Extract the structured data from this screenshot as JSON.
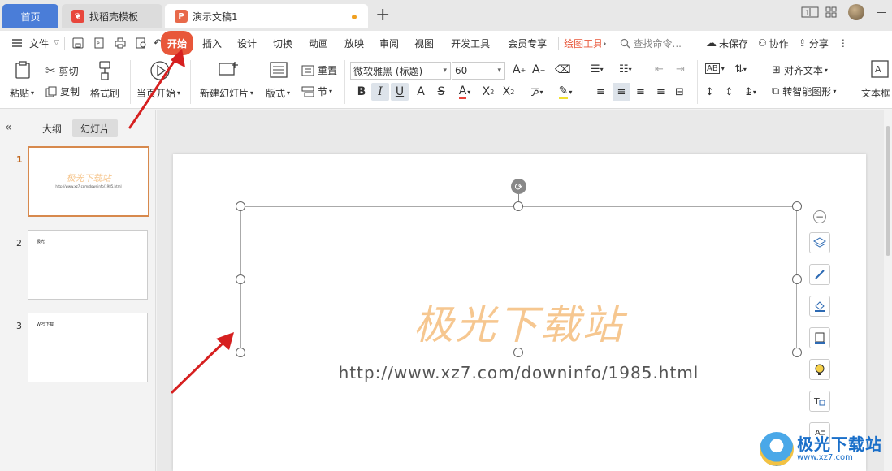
{
  "tabs": {
    "home": "首页",
    "templates": "找稻壳模板",
    "doc": "演示文稿1"
  },
  "menubar": {
    "file": "文件",
    "items": [
      "开始",
      "插入",
      "设计",
      "切换",
      "动画",
      "放映",
      "审阅",
      "视图",
      "开发工具",
      "会员专享",
      "绘图工具"
    ],
    "search_placeholder": "查找命令...",
    "unsaved": "未保存",
    "collab": "协作",
    "share": "分享"
  },
  "ribbon": {
    "paste": "粘贴",
    "cut": "剪切",
    "copy": "复制",
    "format_painter": "格式刷",
    "from_current": "当页开始",
    "new_slide": "新建幻灯片",
    "layout": "版式",
    "section": "节",
    "reset": "重置",
    "font_name": "微软雅黑 (标题)",
    "font_size": "60",
    "align_text": "对齐文本",
    "smart_shape": "转智能图形",
    "textbox": "文本框"
  },
  "panel": {
    "tab_outline": "大纲",
    "tab_slides": "幻灯片",
    "slides": [
      {
        "num": "1",
        "title": "极光下载站",
        "sub": "http://www.xz7.com/downinfo/1985.html"
      },
      {
        "num": "2",
        "title": "极光"
      },
      {
        "num": "3",
        "title": "WPS下载"
      }
    ]
  },
  "slide": {
    "title": "极光下载站",
    "url": "http://www.xz7.com/downinfo/1985.html"
  },
  "watermark": {
    "name": "极光下载站",
    "url": "www.xz7.com"
  },
  "colors": {
    "accent": "#e8573a",
    "home_tab": "#4a7dd8",
    "title_text": "#f6c790",
    "arrow": "#d62020"
  }
}
